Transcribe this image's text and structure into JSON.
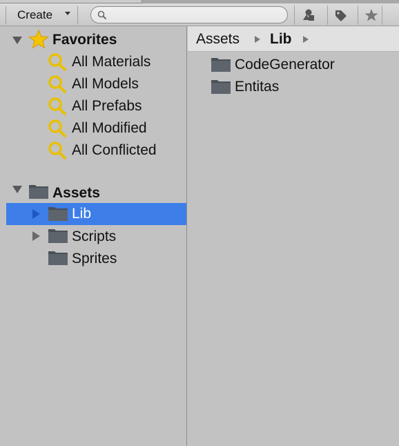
{
  "toolbar": {
    "create_label": "Create",
    "search_placeholder": "",
    "buttons": [
      "filter-by-type-icon",
      "filter-by-label-icon",
      "favorite-star-icon"
    ]
  },
  "favorites": {
    "title": "Favorites",
    "items": [
      {
        "label": "All Materials"
      },
      {
        "label": "All Models"
      },
      {
        "label": "All Prefabs"
      },
      {
        "label": "All Modified"
      },
      {
        "label": "All Conflicted"
      }
    ]
  },
  "assets": {
    "title": "Assets",
    "folders": [
      {
        "label": "Lib",
        "selected": true,
        "expandable": true
      },
      {
        "label": "Scripts",
        "selected": false,
        "expandable": true
      },
      {
        "label": "Sprites",
        "selected": false,
        "expandable": false
      }
    ]
  },
  "breadcrumb": {
    "root": "Assets",
    "current": "Lib"
  },
  "contents": [
    {
      "label": "CodeGenerator"
    },
    {
      "label": "Entitas"
    }
  ],
  "colors": {
    "selection": "#3d7ee8",
    "panel": "#c2c2c2",
    "breadcrumb_bg": "#e1e1e1",
    "favorite_yellow": "#f5c400"
  }
}
